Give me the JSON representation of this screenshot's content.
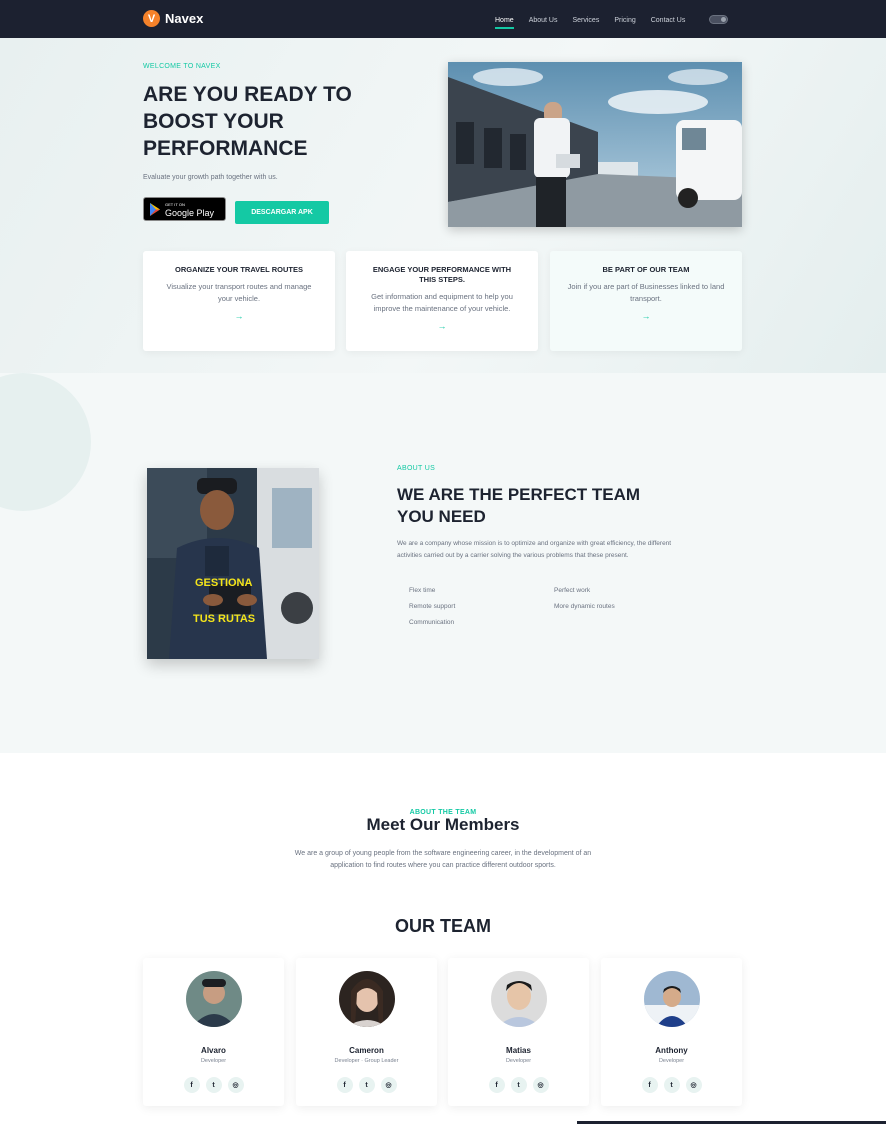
{
  "nav": {
    "brand": "Navex",
    "logo_letter": "V",
    "items": [
      {
        "label": "Home",
        "active": true
      },
      {
        "label": "About Us"
      },
      {
        "label": "Services"
      },
      {
        "label": "Pricing"
      },
      {
        "label": "Contact Us"
      }
    ]
  },
  "hero": {
    "eyebrow": "WELCOME TO NAVEX",
    "title_lines": [
      "ARE YOU READY TO",
      "BOOST YOUR",
      "PERFORMANCE"
    ],
    "subtitle": "Evaluate your growth path together with us.",
    "google_play_small": "GET IT ON",
    "google_play_big": "Google Play",
    "apk_button": "DESCARGAR APK"
  },
  "cards": [
    {
      "title": "ORGANIZE YOUR TRAVEL ROUTES",
      "text": "Visualize your transport routes and manage your vehicle.",
      "arrow": "→"
    },
    {
      "title": "ENGAGE YOUR PERFORMANCE WITH THIS STEPS.",
      "text": "Get information and equipment to help you improve the maintenance of your vehicle.",
      "arrow": "→"
    },
    {
      "title": "BE PART OF OUR TEAM",
      "text": "Join if you are part of Businesses linked to land transport.",
      "arrow": "→"
    }
  ],
  "about": {
    "eyebrow": "ABOUT US",
    "title_lines": [
      "WE ARE THE PERFECT TEAM",
      "YOU NEED"
    ],
    "text": "We are a company whose mission is to optimize and organize with great efficiency, the different activities carried out by a carrier solving the various problems that these present.",
    "photo_caption_1": "GESTIONA",
    "photo_caption_2": "TUS RUTAS",
    "features_left": [
      "Flex time",
      "Remote support",
      "Communication"
    ],
    "features_right": [
      "Perfect work",
      "More dynamic routes"
    ]
  },
  "team": {
    "eyebrow": "ABOUT THE TEAM",
    "title": "Meet Our Members",
    "desc_lines": [
      "We are a group of young people from the software engineering career, in the development of an",
      "application to find routes where you can practice different outdoor sports."
    ],
    "our_team": "OUR TEAM",
    "members": [
      {
        "name": "Alvaro",
        "role": "Developer"
      },
      {
        "name": "Cameron",
        "role": "Developer · Group Leader"
      },
      {
        "name": "Matias",
        "role": "Developer"
      },
      {
        "name": "Anthony",
        "role": "Developer"
      }
    ],
    "social_glyphs": [
      "f",
      "t",
      "◎"
    ]
  },
  "colors": {
    "accent": "#14c9a4",
    "nav_bg": "#1c2130",
    "brand": "#f5822a"
  },
  "icons": [
    "logo-icon",
    "theme-toggle-icon",
    "google-play-icon",
    "arrow-right-icon",
    "facebook-icon",
    "twitter-icon",
    "instagram-icon"
  ]
}
